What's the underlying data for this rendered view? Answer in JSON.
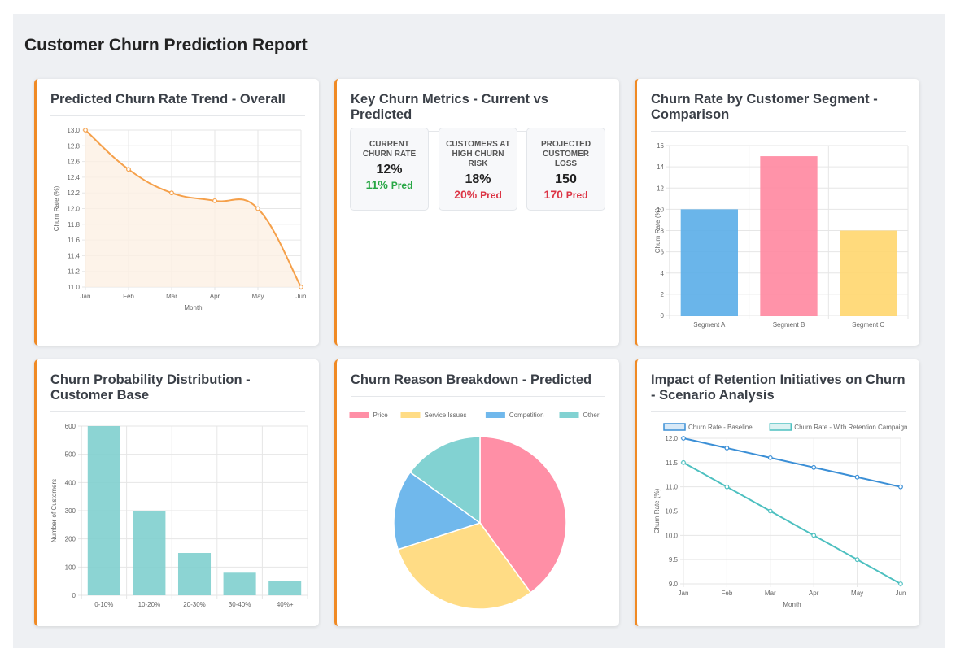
{
  "report": {
    "title": "Customer Churn Prediction Report"
  },
  "colors": {
    "accent": "#f08a24",
    "green": "#28a745",
    "red": "#dc3545"
  },
  "cards": {
    "trend": {
      "title": "Predicted Churn Rate Trend - Overall"
    },
    "metrics": {
      "title": "Key Churn Metrics - Current vs Predicted"
    },
    "segment": {
      "title": "Churn Rate by Customer Segment - Comparison"
    },
    "distribution": {
      "title": "Churn Probability Distribution - Customer Base"
    },
    "reasons": {
      "title": "Churn Reason Breakdown - Predicted"
    },
    "impact": {
      "title": "Impact of Retention Initiatives on Churn - Scenario Analysis"
    }
  },
  "metrics": [
    {
      "label": "CURRENT CHURN RATE",
      "current": "12%",
      "predicted": "11%",
      "pred_suffix": "Pred",
      "pred_color": "#28a745"
    },
    {
      "label": "CUSTOMERS AT HIGH CHURN RISK",
      "current": "18%",
      "predicted": "20%",
      "pred_suffix": "Pred",
      "pred_color": "#dc3545"
    },
    {
      "label": "PROJECTED CUSTOMER LOSS",
      "current": "150",
      "predicted": "170",
      "pred_suffix": "Pred",
      "pred_color": "#dc3545"
    }
  ],
  "chart_data": [
    {
      "id": "trend",
      "type": "line",
      "x": [
        "Jan",
        "Feb",
        "Mar",
        "Apr",
        "May",
        "Jun"
      ],
      "series": [
        {
          "values": [
            13.0,
            12.5,
            12.2,
            12.1,
            12.0,
            11.0
          ],
          "color": "#f5a04a"
        }
      ],
      "xlabel": "Month",
      "ylabel": "Churn Rate (%)",
      "ylim": [
        11.0,
        13.0
      ],
      "yticks": [
        "11.0",
        "11.2",
        "11.4",
        "11.6",
        "11.8",
        "12.0",
        "12.2",
        "12.4",
        "12.6",
        "12.8",
        "13.0"
      ],
      "fill": true,
      "grid": true
    },
    {
      "id": "segment",
      "type": "bar",
      "categories": [
        "Segment A",
        "Segment B",
        "Segment C"
      ],
      "values": [
        10,
        15,
        8
      ],
      "colors": [
        "#5aade8",
        "#ff87a0",
        "#ffd66e"
      ],
      "xlabel": "",
      "ylabel": "Churn Rate (%)",
      "ylim": [
        0,
        16
      ],
      "yticks": [
        "0",
        "2",
        "4",
        "6",
        "8",
        "10",
        "12",
        "14",
        "16"
      ],
      "grid": true
    },
    {
      "id": "distribution",
      "type": "bar",
      "categories": [
        "0-10%",
        "10-20%",
        "20-30%",
        "30-40%",
        "40%+"
      ],
      "values": [
        600,
        300,
        150,
        80,
        50
      ],
      "colors": [
        "#7fcfce"
      ],
      "xlabel": "",
      "ylabel": "Number of Customers",
      "ylim": [
        0,
        600
      ],
      "yticks": [
        "0",
        "100",
        "200",
        "300",
        "400",
        "500",
        "600"
      ],
      "grid": true
    },
    {
      "id": "reasons",
      "type": "pie",
      "labels": [
        "Price",
        "Service Issues",
        "Competition",
        "Other"
      ],
      "values": [
        40,
        30,
        15,
        15
      ],
      "colors": [
        "#ff8fa6",
        "#ffdc85",
        "#70b8ec",
        "#82d2d2"
      ],
      "legend": "top"
    },
    {
      "id": "impact",
      "type": "line",
      "x": [
        "Jan",
        "Feb",
        "Mar",
        "Apr",
        "May",
        "Jun"
      ],
      "series": [
        {
          "name": "Churn Rate - Baseline",
          "values": [
            12.0,
            11.8,
            11.6,
            11.4,
            11.2,
            11.0
          ],
          "color": "#3b8fd6"
        },
        {
          "name": "Churn Rate - With Retention Campaign",
          "values": [
            11.5,
            11.0,
            10.5,
            10.0,
            9.5,
            9.0
          ],
          "color": "#4ec0c0"
        }
      ],
      "xlabel": "Month",
      "ylabel": "Churn Rate (%)",
      "ylim": [
        9.0,
        12.0
      ],
      "yticks": [
        "9.0",
        "9.5",
        "10.0",
        "10.5",
        "11.0",
        "11.5",
        "12.0"
      ],
      "legend": "top",
      "grid": true
    }
  ]
}
